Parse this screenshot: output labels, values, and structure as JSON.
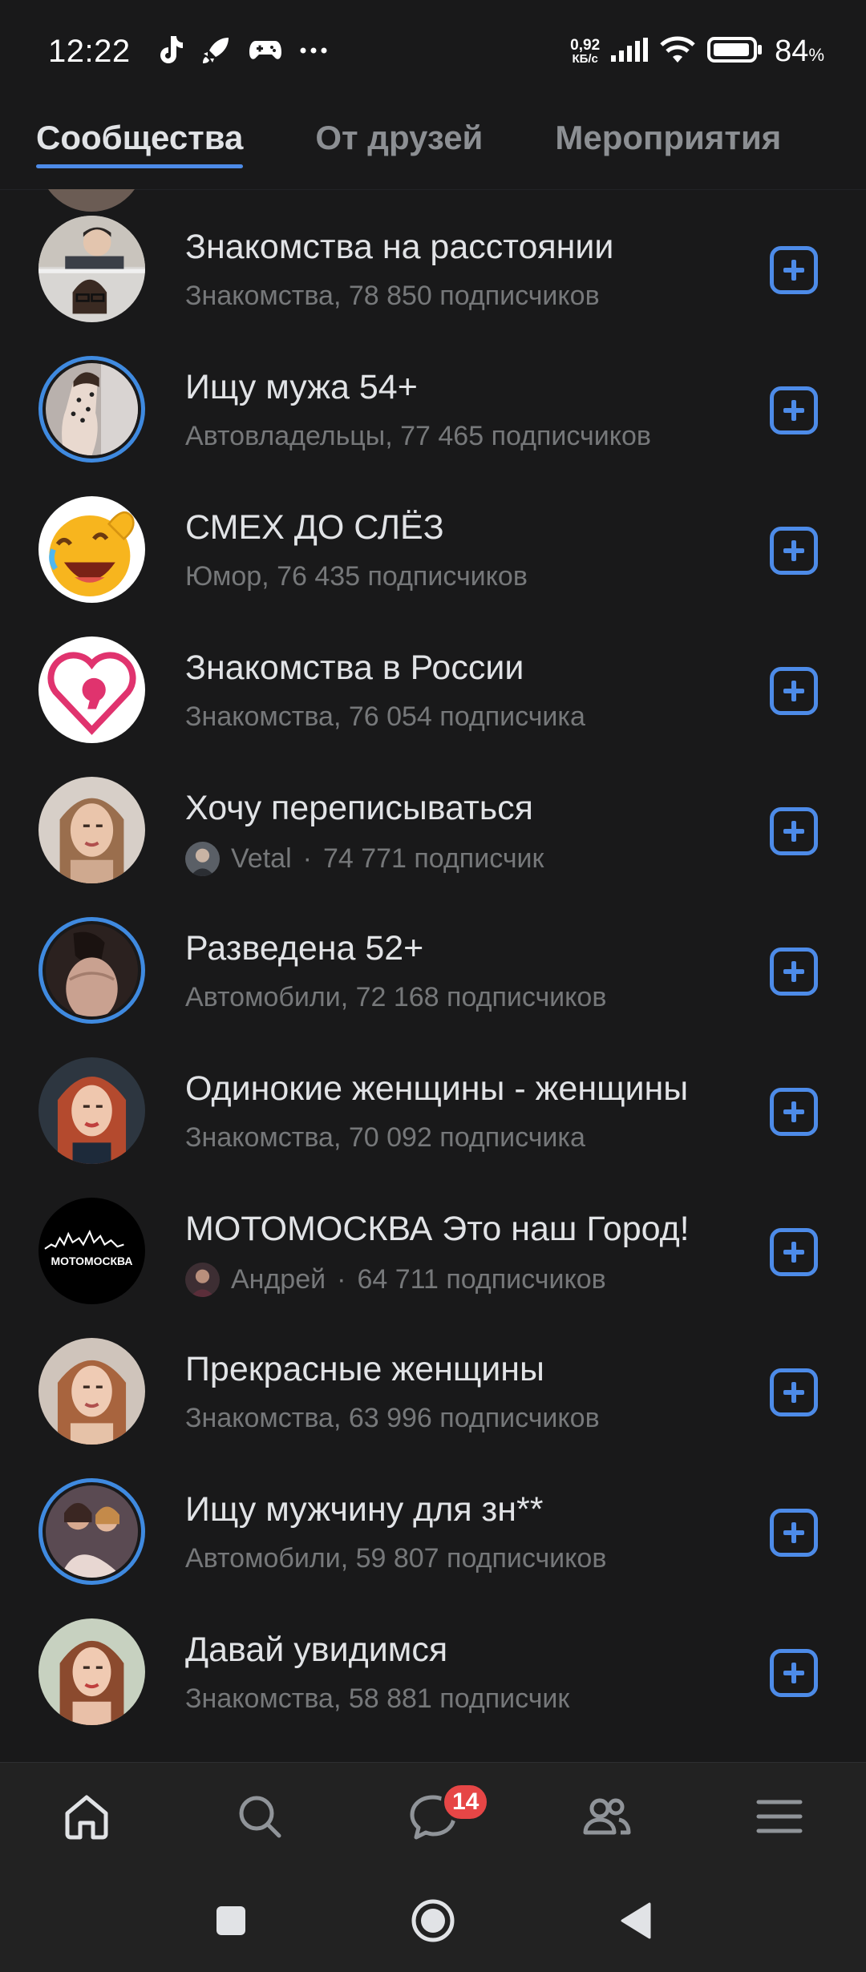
{
  "status_bar": {
    "time": "12:22",
    "net_speed_value": "0,92",
    "net_speed_unit": "КБ/с",
    "battery_percent": "84",
    "battery_sign": "%"
  },
  "tabs": [
    {
      "label": "Сообщества",
      "active": true
    },
    {
      "label": "От друзей",
      "active": false
    },
    {
      "label": "Мероприятия",
      "active": false
    }
  ],
  "communities": [
    {
      "title": "Знакомства на расстоянии",
      "category": "Знакомства",
      "count": "78 850 подписчиков"
    },
    {
      "title": "Ищу мужа 54+",
      "category": "Автовладельцы",
      "count": "77 465 подписчиков"
    },
    {
      "title": "СМЕХ ДО СЛЁЗ",
      "category": "Юмор",
      "count": "76 435 подписчиков"
    },
    {
      "title": "Знакомства в России",
      "category": "Знакомства",
      "count": "76 054 подписчика"
    },
    {
      "title": "Хочу переписываться",
      "friend": "Vetal",
      "count": "74 771 подписчик"
    },
    {
      "title": "Разведена 52+",
      "category": "Автомобили",
      "count": "72 168 подписчиков"
    },
    {
      "title": "Одинокие женщины - женщины",
      "category": "Знакомства",
      "count": "70 092 подписчика"
    },
    {
      "title": "МОТОМОСКВА Это наш Город!",
      "friend": "Андрей",
      "count": "64 711 подписчиков"
    },
    {
      "title": "Прекрасные женщины",
      "category": "Знакомства",
      "count": "63 996 подписчиков"
    },
    {
      "title": "Ищу мужчину для зн**",
      "category": "Автомобили",
      "count": "59 807 подписчиков"
    },
    {
      "title": "Давай увидимся",
      "category": "Знакомства",
      "count": "58 881 подписчик"
    }
  ],
  "logo_text": "МОТОМОСКВА",
  "bottom_nav": {
    "messages_badge": "14",
    "items": [
      "home-icon",
      "search-icon",
      "messages-icon",
      "friends-icon",
      "menu-icon"
    ]
  },
  "colors": {
    "background": "#19191a",
    "accent": "#4d8be8",
    "badge": "#e64646",
    "secondary_text": "#76787a"
  }
}
